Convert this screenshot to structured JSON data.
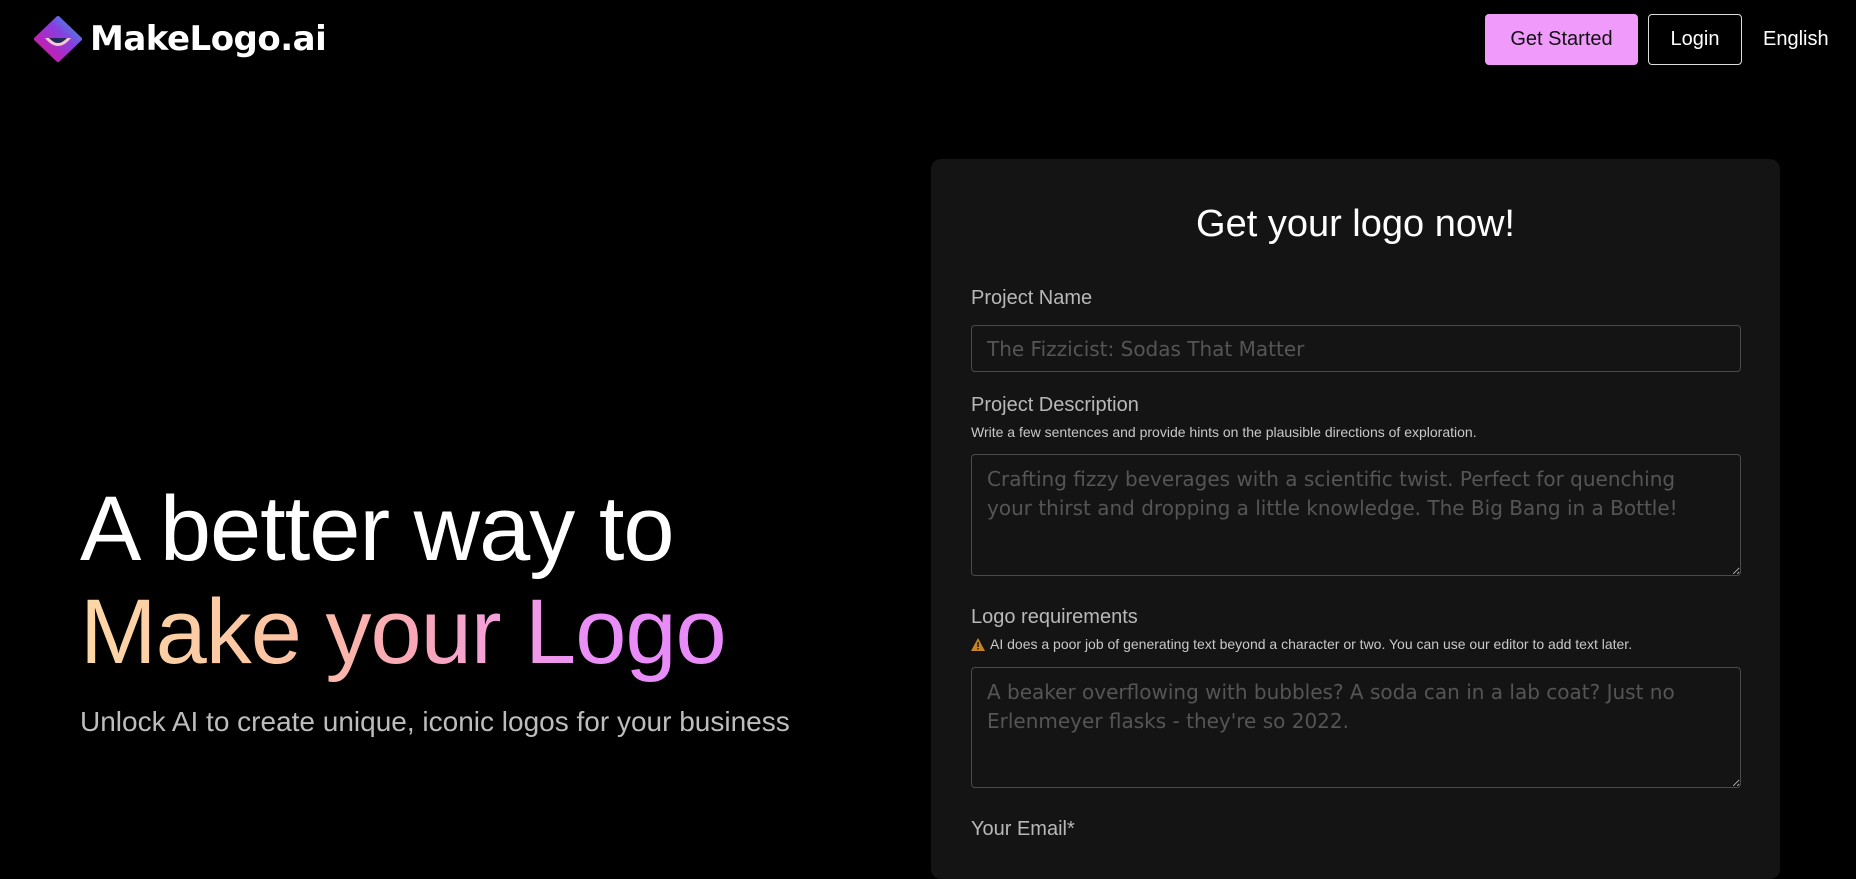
{
  "header": {
    "brand": "MakeLogo.ai",
    "get_started_label": "Get Started",
    "login_label": "Login",
    "language_label": "English"
  },
  "hero": {
    "line1": "A better way to",
    "line2": "Make your Logo",
    "subtitle": "Unlock AI to create unique, iconic logos for your business"
  },
  "form": {
    "title": "Get your logo now!",
    "project_name": {
      "label": "Project Name",
      "placeholder": "The Fizzicist: Sodas That Matter",
      "value": ""
    },
    "project_description": {
      "label": "Project Description",
      "hint": "Write a few sentences and provide hints on the plausible directions of exploration.",
      "placeholder": "Crafting fizzy beverages with a scientific twist. Perfect for quenching your thirst and dropping a little knowledge. The Big Bang in a Bottle!",
      "value": ""
    },
    "logo_requirements": {
      "label": "Logo requirements",
      "warning_icon": "warning-triangle-icon",
      "warning": "AI does a poor job of generating text beyond a character or two. You can use our editor to add text later.",
      "placeholder": "A beaker overflowing with bubbles? A soda can in a lab coat? Just no Erlenmeyer flasks - they're so 2022.",
      "value": ""
    },
    "email": {
      "label": "Your Email*"
    }
  },
  "colors": {
    "accent": "#f09bfb",
    "card_bg": "#141414",
    "warning": "#c8841f"
  }
}
